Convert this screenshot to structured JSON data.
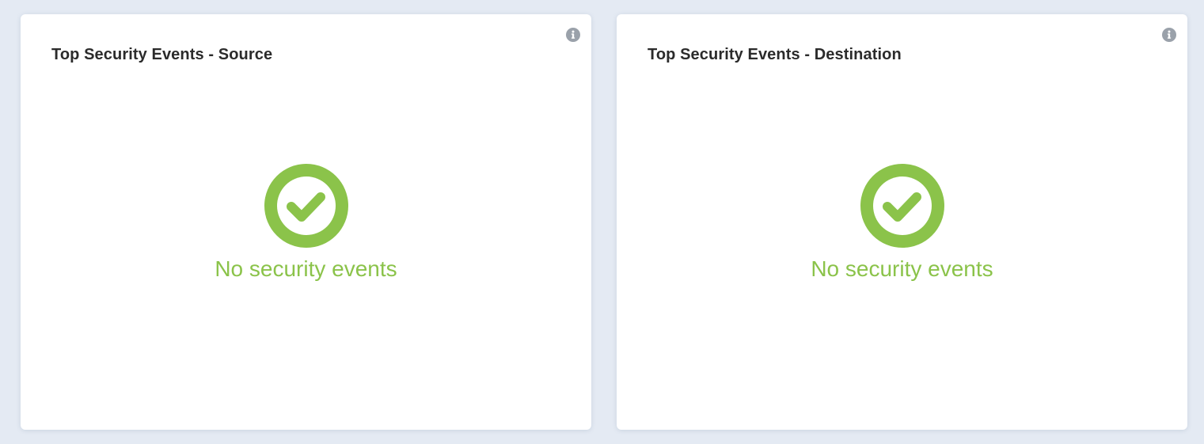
{
  "colors": {
    "background": "#e4eaf3",
    "card": "#ffffff",
    "success": "#8bc34a",
    "title": "#2b2b2b",
    "info_icon": "#9aa1aa"
  },
  "panels": [
    {
      "title": "Top Security Events - Source",
      "info_icon": "info-circle-icon",
      "status_icon": "check-circle-icon",
      "empty_message": "No security events"
    },
    {
      "title": "Top Security Events - Destination",
      "info_icon": "info-circle-icon",
      "status_icon": "check-circle-icon",
      "empty_message": "No security events"
    }
  ]
}
